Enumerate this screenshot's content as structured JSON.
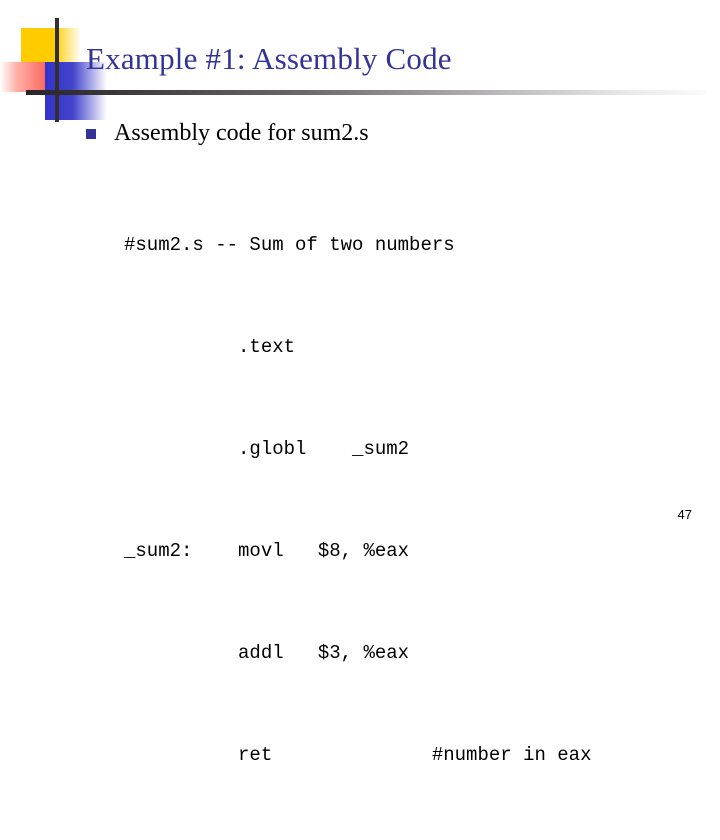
{
  "slide": {
    "title": "Example #1: Assembly Code",
    "page_number": "47",
    "title_color": "#333399",
    "bullet_color": "#333399",
    "body_color": "#000000",
    "background_color": "#ffffff"
  },
  "decor": {
    "yellow_color": "#FFCC00",
    "red_color": "#F8463C",
    "blue_color": "#3333CC",
    "line_color": "#332e30"
  },
  "bullet": {
    "marker": "square-bullet",
    "text": "Assembly code for sum2.s"
  },
  "code": {
    "lines": [
      "#sum2.s -- Sum of two numbers",
      "          .text",
      "          .globl    _sum2",
      "_sum2:    movl   $8, %eax",
      "          addl   $3, %eax",
      "          ret              #number in eax"
    ]
  }
}
